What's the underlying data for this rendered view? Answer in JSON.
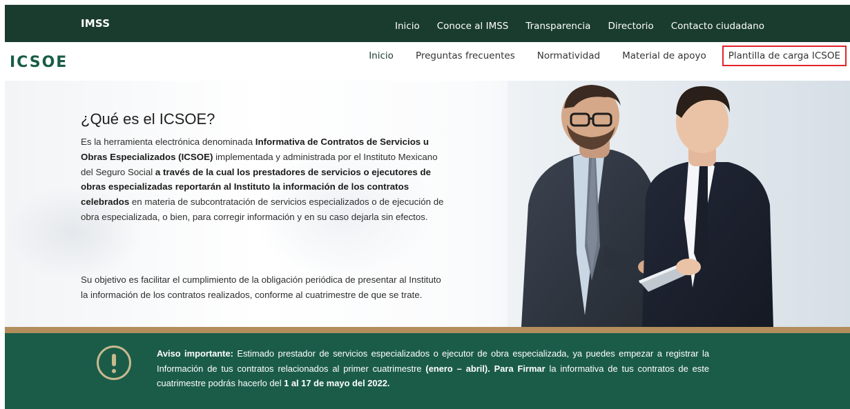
{
  "top_nav": {
    "brand": "IMSS",
    "items": [
      {
        "label": "Inicio"
      },
      {
        "label": "Conoce al IMSS"
      },
      {
        "label": "Transparencia"
      },
      {
        "label": "Directorio"
      },
      {
        "label": "Contacto ciudadano"
      }
    ]
  },
  "sub_nav": {
    "logo": "ICSOE",
    "items": [
      {
        "label": "Inicio"
      },
      {
        "label": "Preguntas frecuentes"
      },
      {
        "label": "Normatividad"
      },
      {
        "label": "Material de apoyo"
      },
      {
        "label": "Plantilla de carga ICSOE"
      }
    ]
  },
  "hero": {
    "title": "¿Qué es el ICSOE?",
    "p1": {
      "t1": "Es la herramienta electrónica denominada ",
      "b1": "Informativa de Contratos de Servicios u Obras Especializados (ICSOE)",
      "t2": " implementada y administrada por el Instituto Mexicano del Seguro Social ",
      "b2": "a través de la cual los prestadores de servicios o ejecutores de obras especializadas reportarán al Instituto la información de los contratos celebrados",
      "t3": " en materia de subcontratación de servicios especializados o de ejecución de obra especializada, o bien, para corregir información y en su caso dejarla sin efectos."
    },
    "p2": "Su objetivo es facilitar el cumplimiento de la obligación periódica de presentar al Instituto la información de los contratos realizados, conforme al cuatrimestre de que se trate."
  },
  "notice": {
    "label": "Aviso importante:",
    "t1": " Estimado prestador de servicios especializados o ejecutor de obra especializada, ya puedes empezar a registrar la Información de tus contratos relacionados al primer cuatrimestre ",
    "b1": "(enero – abril). Para Firmar",
    "t2": " la informativa de tus contratos de este cuatrimestre podrás hacerlo del ",
    "b2": "1 al 17 de mayo del 2022."
  },
  "colors": {
    "top_bar": "#1a3c2f",
    "logo": "#1a5c45",
    "highlight_border": "#e1232b",
    "gold": "#b38e5d",
    "notice_bg": "#1b5c49"
  },
  "icons": {
    "notice": "exclamation-circle-icon"
  }
}
